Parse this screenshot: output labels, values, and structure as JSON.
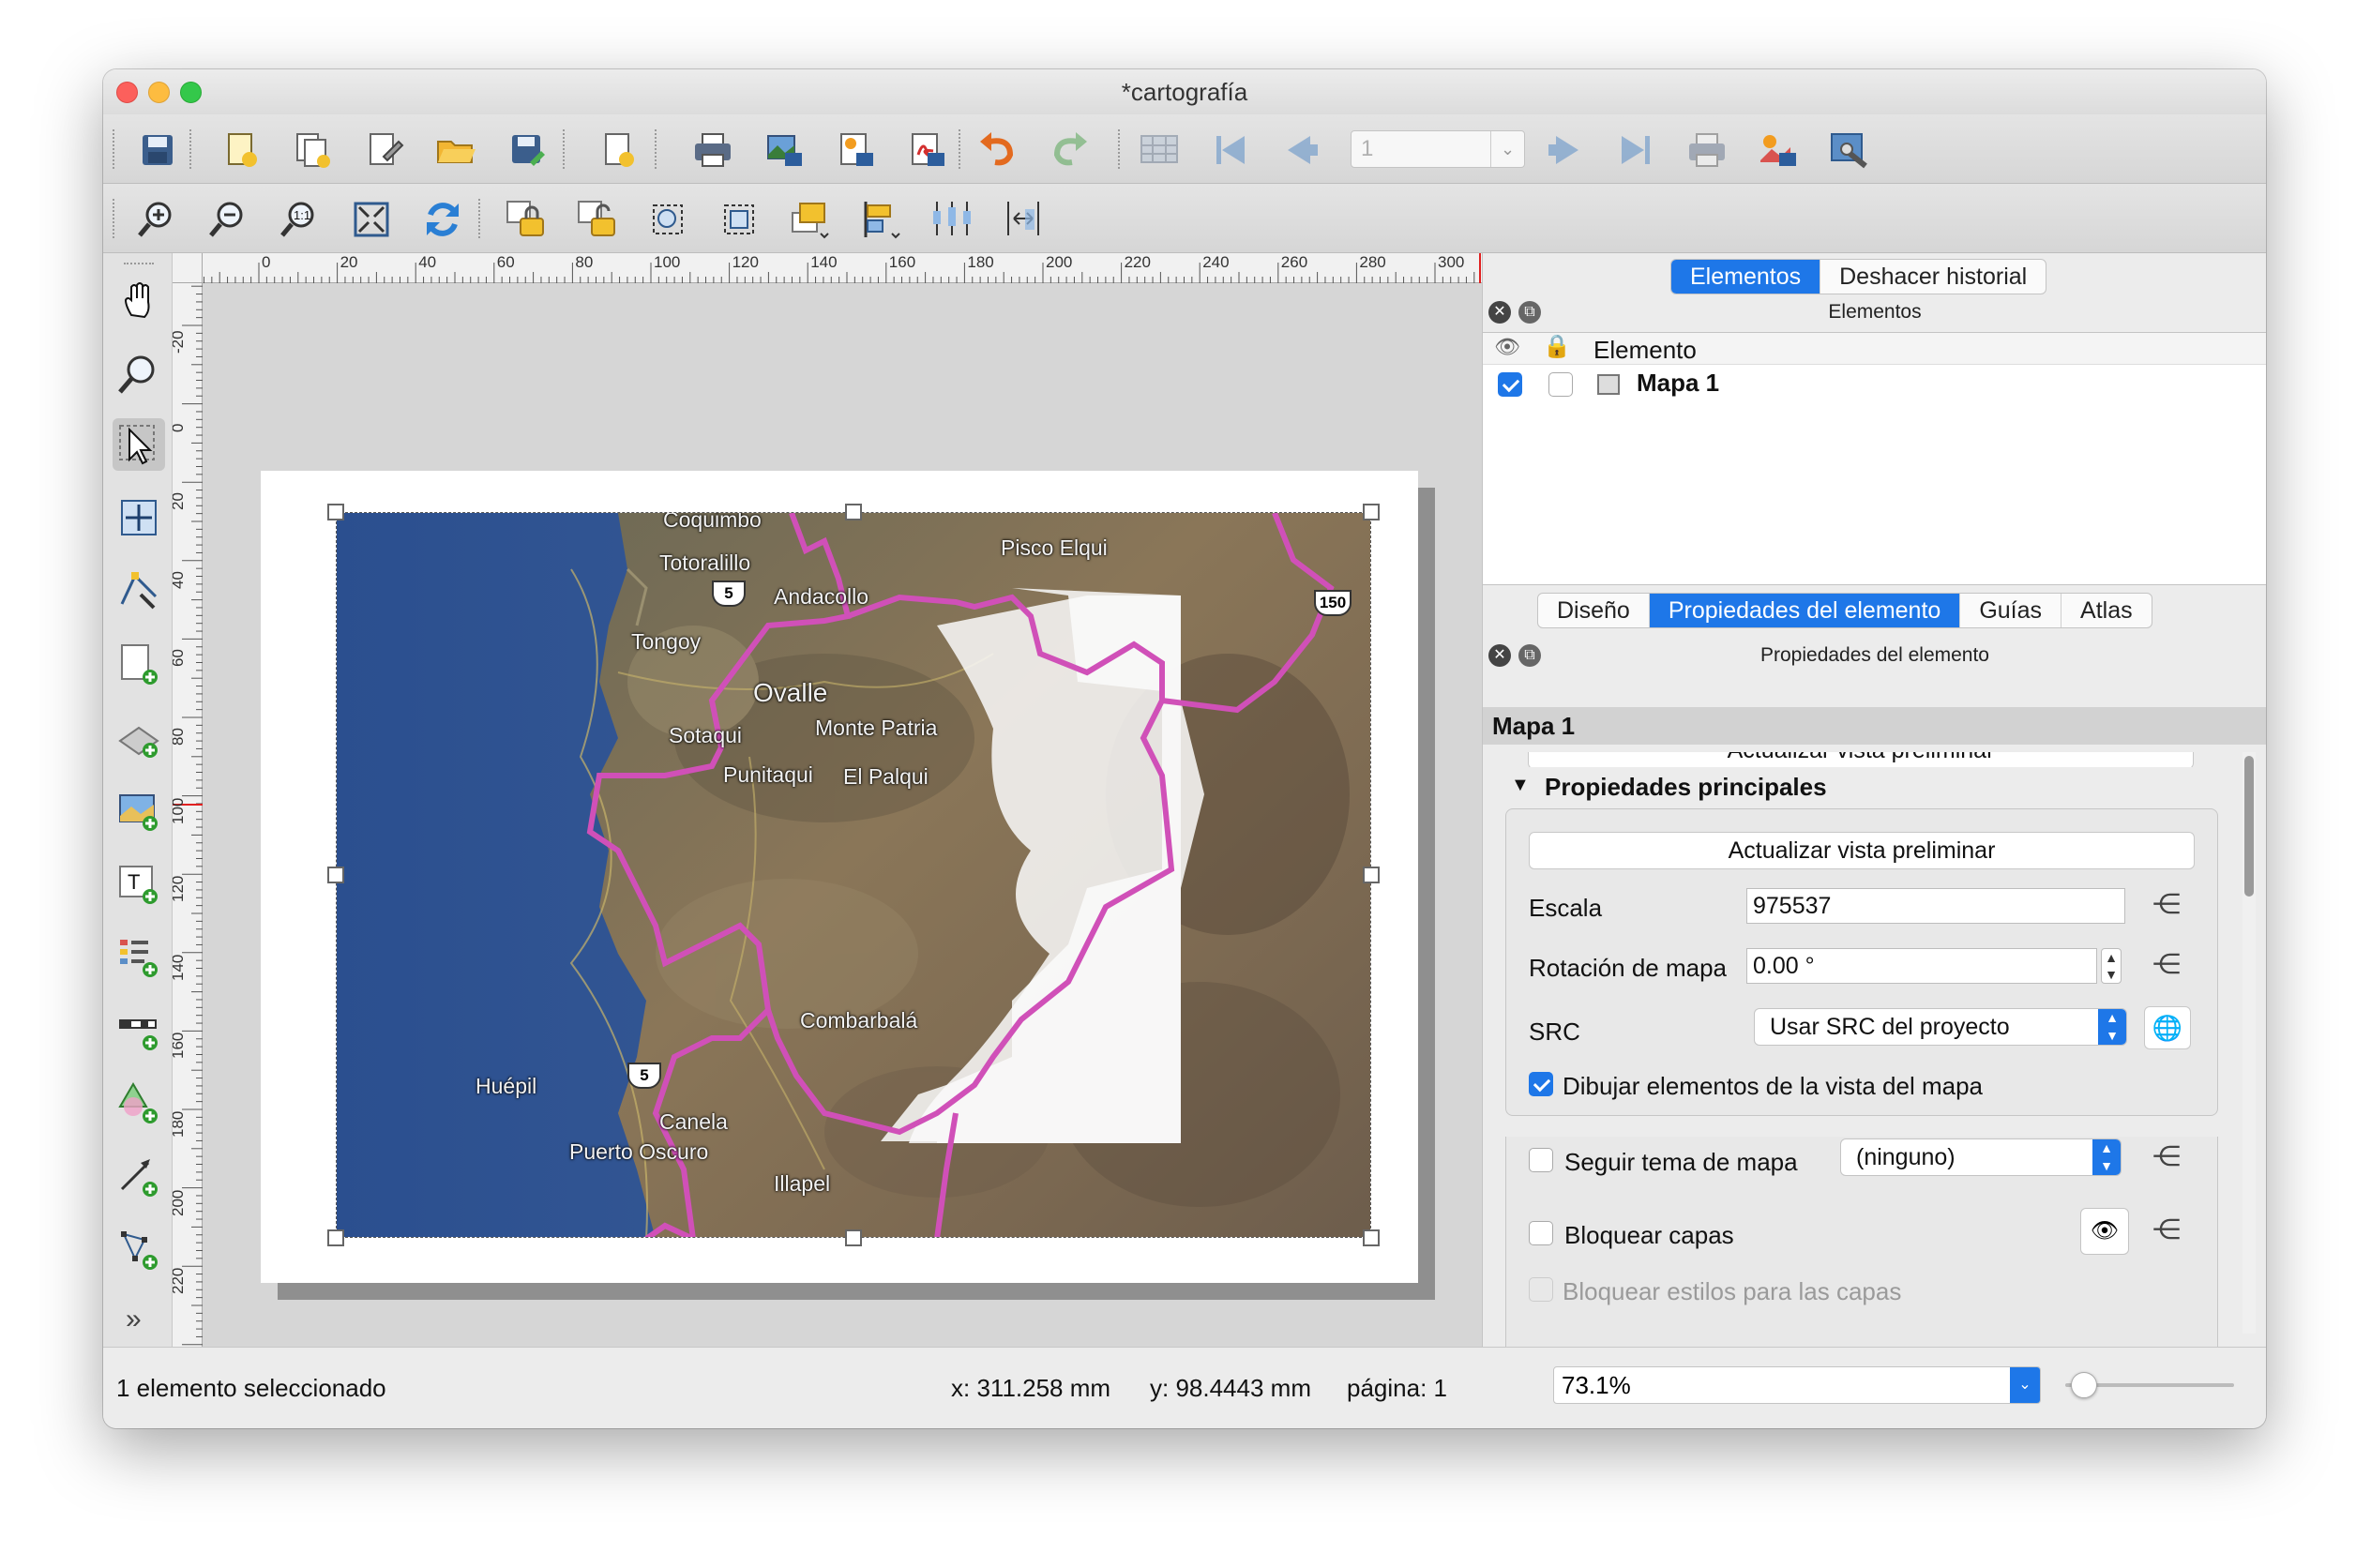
{
  "window": {
    "title": "*cartografía"
  },
  "toolbar_top": {
    "page_combo": "1"
  },
  "rulers": {
    "h_labels": [
      "0",
      "20",
      "40",
      "60",
      "80",
      "100",
      "120",
      "140",
      "160",
      "180",
      "200",
      "220",
      "240",
      "260",
      "280",
      "300"
    ],
    "v_labels": [
      "-20",
      "0",
      "20",
      "40",
      "60",
      "80",
      "100",
      "120",
      "140",
      "160",
      "180",
      "200",
      "220"
    ]
  },
  "map": {
    "places": [
      {
        "name": "Coquimbo"
      },
      {
        "name": "Totoralillo"
      },
      {
        "name": "Andacollo"
      },
      {
        "name": "Pisco Elqui"
      },
      {
        "name": "Tongoy"
      },
      {
        "name": "Ovalle"
      },
      {
        "name": "Monte Patria"
      },
      {
        "name": "Sotaqui"
      },
      {
        "name": "Punitaqui"
      },
      {
        "name": "El Palqui"
      },
      {
        "name": "Combarbalá"
      },
      {
        "name": "Huépil"
      },
      {
        "name": "Canela"
      },
      {
        "name": "Puerto Oscuro"
      },
      {
        "name": "Illapel"
      }
    ],
    "shields": [
      "5",
      "5",
      "150"
    ]
  },
  "right_panel": {
    "top_tabs": [
      "Elementos",
      "Deshacer historial"
    ],
    "elements_dock_title": "Elementos",
    "tree_header": "Elemento",
    "tree_item": "Mapa 1",
    "mid_tabs": [
      "Diseño",
      "Propiedades del elemento",
      "Guías",
      "Atlas"
    ],
    "props_dock_title": "Propiedades del elemento",
    "item_title": "Mapa 1",
    "cut_button": "Actualizar vista preliminar",
    "section_title": "Propiedades principales",
    "update_button": "Actualizar vista preliminar",
    "scale_label": "Escala",
    "scale_value": "975537",
    "rotation_label": "Rotación de mapa",
    "rotation_value": "0.00 °",
    "src_label": "SRC",
    "src_value": "Usar SRC del proyecto",
    "draw_items_label": "Dibujar elementos de la vista del mapa",
    "follow_theme_label": "Seguir tema de mapa",
    "follow_theme_value": "(ninguno)",
    "lock_layers_label": "Bloquear capas",
    "lock_styles_label": "Bloquear estilos para las capas"
  },
  "status": {
    "selection": "1 elemento seleccionado",
    "x": "x: 311.258 mm",
    "y": "y: 98.4443 mm",
    "page": "página: 1",
    "zoom": "73.1%"
  },
  "colors": {
    "accent": "#1e77e8",
    "boundary": "#d050b8"
  }
}
